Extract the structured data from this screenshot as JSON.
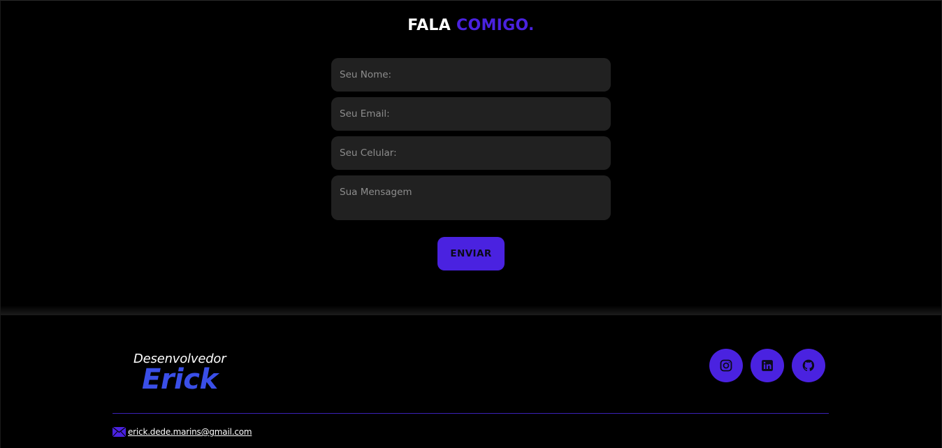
{
  "contact": {
    "title_main": "FALA",
    "title_accent": "COMIGO.",
    "fields": {
      "name_placeholder": "Seu Nome:",
      "email_placeholder": "Seu Email:",
      "phone_placeholder": "Seu Celular:",
      "message_placeholder": "Sua Mensagem"
    },
    "send_label": "ENVIAR"
  },
  "footer": {
    "logo_top": "Desenvolvedor",
    "logo_name": "Erick",
    "socials": [
      {
        "name": "instagram",
        "icon": "instagram-icon"
      },
      {
        "name": "linkedin",
        "icon": "linkedin-icon"
      },
      {
        "name": "github",
        "icon": "github-icon"
      }
    ],
    "email_icon": "mail-icon",
    "email": "erick.dede.marins@gmail.com"
  },
  "colors": {
    "accent": "#4a22e0",
    "logo_blue": "#3a4fe8",
    "field_bg": "#212121",
    "background": "#000000"
  }
}
